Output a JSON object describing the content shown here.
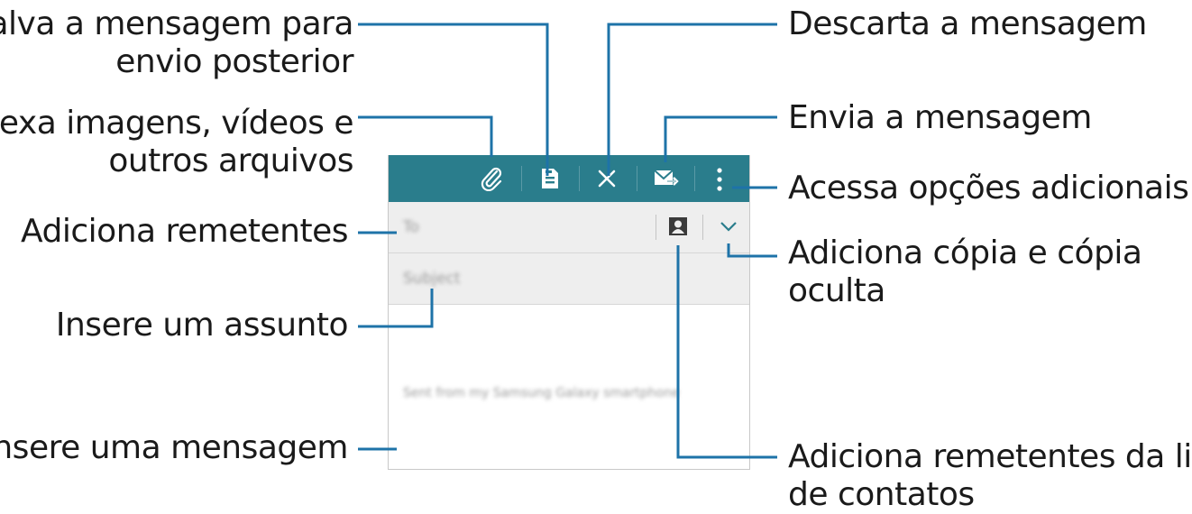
{
  "callouts": {
    "save": "Salva a mensagem para",
    "save_2": "envio posterior",
    "attach": "Anexa imagens, vídeos e",
    "attach_2": "outros arquivos",
    "add_recipients": "Adiciona remetentes",
    "subject": "Insere um assunto",
    "message": "Insere uma mensagem",
    "discard": "Descarta a mensagem",
    "send": "Envia a mensagem",
    "more_options": "Acessa opções adicionais",
    "cc_bcc": "Adiciona cópia e cópia",
    "cc_bcc_2": "oculta",
    "contacts": "Adiciona remetentes da lista",
    "contacts_2": "de contatos"
  },
  "compose": {
    "to_placeholder": "To",
    "subject_placeholder": "Subject",
    "signature": "Sent from my Samsung Galaxy smartphone"
  },
  "colors": {
    "toolbar": "#2a7d8c",
    "callout_line": "#1e73a8"
  },
  "icons": [
    "attach-icon",
    "save-icon",
    "close-icon",
    "send-icon",
    "more-icon",
    "contact-icon",
    "chevron-down-icon"
  ]
}
